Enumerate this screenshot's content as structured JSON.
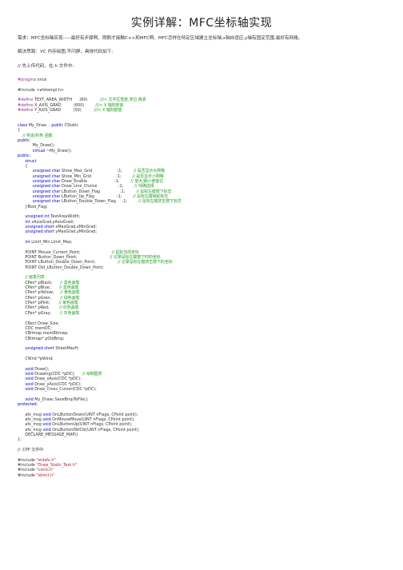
{
  "document": {
    "title": "实例详解：MFC坐标轴实现",
    "intro_line_1": "需求：MFC坐标轴实现-----最好有步骤啊，刚刚才接触C++和MFC啊。MFC怎样在特定区域建立坐标轴,x轴自适应,y轴有固定范围,最好有网格。",
    "intro_line_2": "解决思路：VC 内存绘图,不闪屏，具体代码如下:",
    "intro_line_3": "// 先上传代码，在.h 文件中:"
  },
  "code_lines": [
    [
      [
        "pp",
        "#pragma"
      ],
      [
        "pl",
        " once"
      ]
    ],
    [
      [
        "pl",
        ""
      ]
    ],
    [
      [
        "pl",
        "#include <afxtempl.h>"
      ]
    ],
    [
      [
        "pl",
        ""
      ]
    ],
    [
      [
        "pp",
        "#define"
      ],
      [
        "pl",
        " TEXT_AREA_WIDTH      (60)          "
      ],
      [
        "cm",
        "///< 文字区宽度,单位 像素"
      ]
    ],
    [
      [
        "pp",
        "#define"
      ],
      [
        "pl",
        " X_AXIS_GRAD          (600)         "
      ],
      [
        "cm",
        "///< X 轴刻度值"
      ]
    ],
    [
      [
        "pp",
        "#define"
      ],
      [
        "pl",
        " Y_AXIS_GRAD          (50)          "
      ],
      [
        "cm",
        "///< X 轴刻度值"
      ]
    ],
    [
      [
        "pl",
        ""
      ]
    ],
    [
      [
        "pl",
        ""
      ]
    ],
    [
      [
        "kw",
        "class"
      ],
      [
        "pl",
        " My_Draw  : "
      ],
      [
        "kw",
        "public"
      ],
      [
        "pl",
        " CStatic"
      ]
    ],
    [
      [
        "pl",
        "{"
      ]
    ],
    [
      [
        "cm",
        "    // 构造/析构 函数"
      ]
    ],
    [
      [
        "kw",
        "public"
      ],
      [
        "pl",
        ":"
      ]
    ],
    [
      [
        "pl",
        "            My_Draw();"
      ]
    ],
    [
      [
        "pl",
        "            "
      ],
      [
        "kw",
        "virtual"
      ],
      [
        "pl",
        " ~My_Draw();"
      ]
    ],
    [
      [
        "kw",
        "public"
      ],
      [
        "pl",
        ":"
      ]
    ],
    [
      [
        "pl",
        "      "
      ],
      [
        "kw",
        "struct"
      ]
    ],
    [
      [
        "pl",
        "      {"
      ]
    ],
    [
      [
        "pl",
        "            "
      ],
      [
        "kw",
        "unsigned char"
      ],
      [
        "pl",
        " Show_Max_Grid                    :1;         "
      ],
      [
        "cm",
        "// 是否显示大网格"
      ]
    ],
    [
      [
        "pl",
        "            "
      ],
      [
        "kw",
        "unsigned char"
      ],
      [
        "pl",
        " Show_Min_Grid                    :1;         "
      ],
      [
        "cm",
        "// 是否显示小网格"
      ]
    ],
    [
      [
        "pl",
        "            "
      ],
      [
        "kw",
        "unsigned char"
      ],
      [
        "pl",
        " Draw_Enable                      :1;         "
      ],
      [
        "cm",
        "// 放大/缩小使能位"
      ]
    ],
    [
      [
        "pl",
        "            "
      ],
      [
        "kw",
        "unsigned char"
      ],
      [
        "pl",
        " Draw_Line_Choice                 :1;         "
      ],
      [
        "cm",
        "// 线确选择"
      ]
    ],
    [
      [
        "pl",
        "            "
      ],
      [
        "kw",
        "unsigned char"
      ],
      [
        "pl",
        " LButton_Down_Flag                :1;         "
      ],
      [
        "cm",
        "// 鼠标左键按下标志"
      ]
    ],
    [
      [
        "pl",
        "            "
      ],
      [
        "kw",
        "unsigned char"
      ],
      [
        "pl",
        " LButton_Up_Flag                  :1;         "
      ],
      [
        "cm",
        "// 鼠标左键弹起标志"
      ]
    ],
    [
      [
        "pl",
        "            "
      ],
      [
        "kw",
        "unsigned char"
      ],
      [
        "pl",
        " LButton_Double_Down_Flag     :1;         "
      ],
      [
        "cm",
        "// 鼠标左键双击按下标志"
      ]
    ],
    [
      [
        "pl",
        "      }Bool_Flag;"
      ]
    ],
    [
      [
        "pl",
        ""
      ]
    ],
    [
      [
        "pl",
        "      "
      ],
      [
        "kw",
        "unsigned int"
      ],
      [
        "pl",
        " TextAreaWidth;"
      ]
    ],
    [
      [
        "pl",
        "      "
      ],
      [
        "kw",
        "int"
      ],
      [
        "pl",
        " xAxisGrad,yAxisGrad;"
      ]
    ],
    [
      [
        "pl",
        "      "
      ],
      [
        "kw",
        "unsigned short"
      ],
      [
        "pl",
        " xMaxGrad,xMinGrad;"
      ]
    ],
    [
      [
        "pl",
        "      "
      ],
      [
        "kw",
        "unsigned short"
      ],
      [
        "pl",
        " yMaxGrad,yMinGrad;"
      ]
    ],
    [
      [
        "pl",
        ""
      ]
    ],
    [
      [
        "pl",
        "      "
      ],
      [
        "kw",
        "int"
      ],
      [
        "pl",
        " Limit_Min,Limit_Max;"
      ]
    ],
    [
      [
        "pl",
        ""
      ]
    ],
    [
      [
        "pl",
        "      POINT Mouse_Current_Point;                         "
      ],
      [
        "cm",
        "// 鼠标当前坐标"
      ]
    ],
    [
      [
        "pl",
        "      POINT Button_Down_Point;                          "
      ],
      [
        "cm",
        "// 记录鼠标左键按下时的坐标"
      ]
    ],
    [
      [
        "pl",
        "      POINT LButton_Double_Down_Point;                  "
      ],
      [
        "cm",
        "// 记录鼠标左键双击按下的坐标"
      ]
    ],
    [
      [
        "pl",
        "      POINT Old_LButton_Double_Down_Point;"
      ]
    ],
    [
      [
        "pl",
        ""
      ]
    ],
    [
      [
        "cm",
        "      // 画笔列表"
      ]
    ],
    [
      [
        "pl",
        "      CPen* pBlack;      "
      ],
      [
        "cm",
        "// 黑色画笔"
      ]
    ],
    [
      [
        "pl",
        "      CPen* pBlue;       "
      ],
      [
        "cm",
        "// 蓝色画笔"
      ]
    ],
    [
      [
        "pl",
        "      CPen* pYellow;     "
      ],
      [
        "cm",
        "// 黄色画笔"
      ]
    ],
    [
      [
        "pl",
        "      CPen* pGren;       "
      ],
      [
        "cm",
        "// 绿色画笔"
      ]
    ],
    [
      [
        "pl",
        "      CPen* pPink;       "
      ],
      [
        "cm",
        "// 紫色画笔"
      ]
    ],
    [
      [
        "pl",
        "      CPen* pRed;        "
      ],
      [
        "cm",
        "// 红色画笔"
      ]
    ],
    [
      [
        "pl",
        "      CPen* pGray;       "
      ],
      [
        "cm",
        "// 灰色画笔"
      ]
    ],
    [
      [
        "pl",
        ""
      ]
    ],
    [
      [
        "pl",
        "      CRect Draw_Size;"
      ]
    ],
    [
      [
        "pl",
        "      CDC memDC;"
      ]
    ],
    [
      [
        "pl",
        "      CBitmap memBitmap;"
      ]
    ],
    [
      [
        "pl",
        "      CBitmap* pOldBmp;"
      ]
    ],
    [
      [
        "pl",
        ""
      ]
    ],
    [
      [
        "pl",
        "      "
      ],
      [
        "kw",
        "unsigned short"
      ],
      [
        "pl",
        " SheetMaxH;"
      ]
    ],
    [
      [
        "pl",
        ""
      ]
    ],
    [
      [
        "pl",
        "      CWnd *pWind;"
      ]
    ],
    [
      [
        "pl",
        ""
      ]
    ],
    [
      [
        "pl",
        "      "
      ],
      [
        "kw",
        "void"
      ],
      [
        "pl",
        " Draw();"
      ]
    ],
    [
      [
        "pl",
        "      "
      ],
      [
        "kw",
        "void"
      ],
      [
        "pl",
        " Drawing(CDC *pDC);      "
      ],
      [
        "cm",
        "// 绘制图表"
      ]
    ],
    [
      [
        "pl",
        "      "
      ],
      [
        "kw",
        "void"
      ],
      [
        "pl",
        " Draw_xAxis(CDC *pDC);"
      ]
    ],
    [
      [
        "pl",
        "      "
      ],
      [
        "kw",
        "void"
      ],
      [
        "pl",
        " Draw_yAxis(CDC *pDC);"
      ]
    ],
    [
      [
        "pl",
        "      "
      ],
      [
        "kw",
        "void"
      ],
      [
        "pl",
        " Draw_Cross_Cursor(CDC *pDC);"
      ]
    ],
    [
      [
        "pl",
        ""
      ]
    ],
    [
      [
        "pl",
        "      "
      ],
      [
        "kw",
        "void"
      ],
      [
        "pl",
        " My_Draw::SaveBmpToFile();"
      ]
    ],
    [
      [
        "kw",
        "protected"
      ],
      [
        "pl",
        ":"
      ]
    ],
    [
      [
        "pl",
        ""
      ]
    ],
    [
      [
        "pl",
        "      afx_msg "
      ],
      [
        "kw",
        "void"
      ],
      [
        "pl",
        " OnLButtonDown(UINT nFlags, CPoint point);"
      ]
    ],
    [
      [
        "pl",
        "      afx_msg "
      ],
      [
        "kw",
        "void"
      ],
      [
        "pl",
        " OnMouseMove(UINT nFlags, CPoint point);"
      ]
    ],
    [
      [
        "pl",
        "      afx_msg "
      ],
      [
        "kw",
        "void"
      ],
      [
        "pl",
        " OnLButtonUp(UINT nFlags, CPoint point);"
      ]
    ],
    [
      [
        "pl",
        "      afx_msg "
      ],
      [
        "kw",
        "void"
      ],
      [
        "pl",
        " OnLButtonDblClk(UINT nFlags, CPoint point);"
      ]
    ],
    [
      [
        "pl",
        "      DECLARE_MESSAGE_MAP()"
      ]
    ],
    [
      [
        "pl",
        "};"
      ]
    ],
    [
      [
        "pl",
        ""
      ]
    ],
    [
      [
        "pl",
        "// .CPP 文件中:"
      ]
    ],
    [
      [
        "pl",
        ""
      ]
    ],
    [
      [
        "pl",
        "#include "
      ],
      [
        "st",
        "\"stdafx.h\""
      ]
    ],
    [
      [
        "pl",
        "#include "
      ],
      [
        "st",
        "\"Draw_Static_Text.h\""
      ]
    ],
    [
      [
        "pl",
        "#include "
      ],
      [
        "st",
        "\"conio.h\""
      ]
    ],
    [
      [
        "pl",
        "#include "
      ],
      [
        "st",
        "\"direct.h\""
      ]
    ]
  ],
  "colors": {
    "keyword": "#0000cc",
    "preprocessor": "#8b3d8b",
    "comment": "#1f9a1f",
    "string": "#b2232d",
    "text": "#333333"
  }
}
